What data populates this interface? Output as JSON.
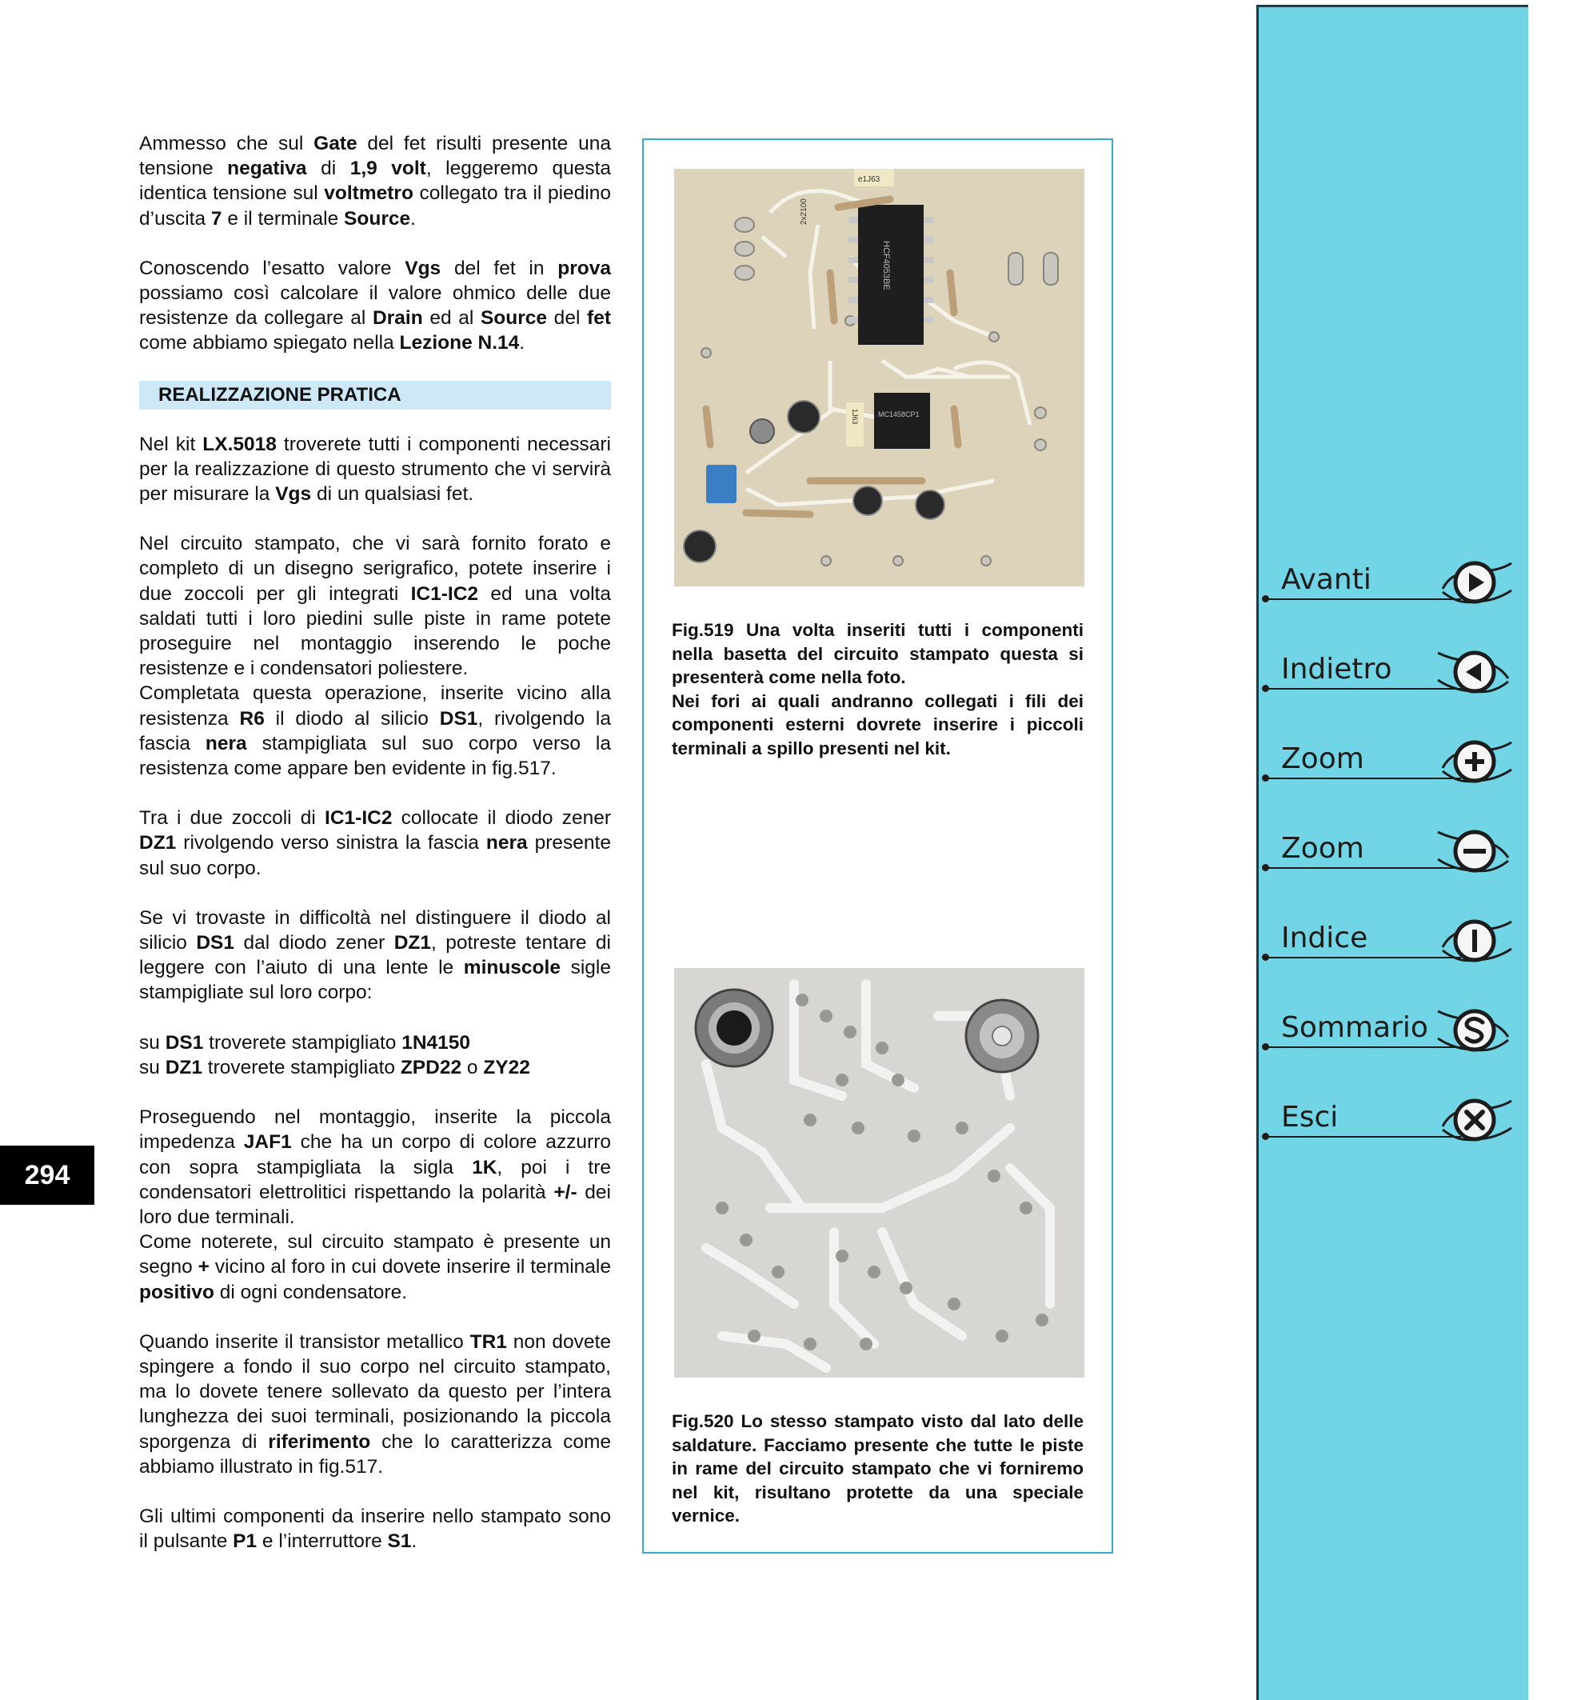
{
  "page_number": "294",
  "left_column": {
    "p1": [
      {
        "t": "Ammesso che sul "
      },
      {
        "b": "Gate"
      },
      {
        "t": " del fet risulti presente una tensione "
      },
      {
        "b": "negativa"
      },
      {
        "t": " di "
      },
      {
        "b": "1,9 volt"
      },
      {
        "t": ", leggeremo questa identica tensione sul "
      },
      {
        "b": "voltmetro"
      },
      {
        "t": " collegato tra il piedino d’uscita "
      },
      {
        "b": "7"
      },
      {
        "t": " e il terminale "
      },
      {
        "b": "Source"
      },
      {
        "t": "."
      }
    ],
    "p2": [
      {
        "t": "Conoscendo l’esatto valore "
      },
      {
        "b": "Vgs"
      },
      {
        "t": " del fet in "
      },
      {
        "b": "prova"
      },
      {
        "t": " possiamo così calcolare il valore ohmico delle due resistenze da collegare al "
      },
      {
        "b": "Drain"
      },
      {
        "t": " ed al "
      },
      {
        "b": "Source"
      },
      {
        "t": " del "
      },
      {
        "b": "fet"
      },
      {
        "t": " come abbiamo spiegato nella "
      },
      {
        "b": "Lezione N.14"
      },
      {
        "t": "."
      }
    ],
    "section_heading": "REALIZZAZIONE PRATICA",
    "p3": [
      {
        "t": "Nel kit "
      },
      {
        "b": "LX.5018"
      },
      {
        "t": " troverete tutti i componenti necessari per la realizzazione di questo strumento che vi servirà per misurare la "
      },
      {
        "b": "Vgs"
      },
      {
        "t": " di un qualsiasi fet."
      }
    ],
    "p4": [
      {
        "t": "Nel circuito stampato, che vi sarà fornito forato e completo di un disegno serigrafico, potete inserire i due zoccoli per gli integrati "
      },
      {
        "b": "IC1-IC2"
      },
      {
        "t": " ed una volta saldati tutti i loro piedini sulle piste in rame potete proseguire nel montaggio inserendo le poche resistenze e i condensatori poliestere."
      }
    ],
    "p5": [
      {
        "t": "Completata questa operazione, inserite vicino alla resistenza "
      },
      {
        "b": "R6"
      },
      {
        "t": " il diodo al silicio "
      },
      {
        "b": "DS1"
      },
      {
        "t": ", rivolgendo la fascia "
      },
      {
        "b": "nera"
      },
      {
        "t": " stampigliata sul suo corpo verso la resistenza come appare ben evidente in fig.517."
      }
    ],
    "p6": [
      {
        "t": "Tra i due zoccoli di "
      },
      {
        "b": "IC1-IC2"
      },
      {
        "t": " collocate il diodo zener "
      },
      {
        "b": "DZ1"
      },
      {
        "t": " rivolgendo verso sinistra la fascia "
      },
      {
        "b": "nera"
      },
      {
        "t": " presente sul suo corpo."
      }
    ],
    "p7": [
      {
        "t": "Se vi trovaste in difficoltà nel distinguere il diodo al silicio "
      },
      {
        "b": "DS1"
      },
      {
        "t": " dal diodo zener "
      },
      {
        "b": "DZ1"
      },
      {
        "t": ", potreste tentare di leggere con l’aiuto di una lente le "
      },
      {
        "b": "minuscole"
      },
      {
        "t": " sigle stampigliate sul loro corpo:"
      }
    ],
    "p8a": [
      {
        "t": "su "
      },
      {
        "b": "DS1"
      },
      {
        "t": " troverete stampigliato "
      },
      {
        "b": "1N4150"
      }
    ],
    "p8b": [
      {
        "t": "su "
      },
      {
        "b": "DZ1"
      },
      {
        "t": " troverete stampigliato "
      },
      {
        "b": "ZPD22"
      },
      {
        "t": " o "
      },
      {
        "b": "ZY22"
      }
    ],
    "p9": [
      {
        "t": "Proseguendo nel montaggio, inserite la piccola impedenza "
      },
      {
        "b": "JAF1"
      },
      {
        "t": " che ha un corpo di colore azzurro con sopra stampigliata la sigla "
      },
      {
        "b": "1K"
      },
      {
        "t": ", poi i tre condensatori elettrolitici rispettando la polarità "
      },
      {
        "b": "+/-"
      },
      {
        "t": " dei loro due terminali."
      }
    ],
    "p10": [
      {
        "t": "Come noterete, sul circuito stampato è presente un segno "
      },
      {
        "b": "+"
      },
      {
        "t": " vicino al foro in cui dovete inserire il terminale "
      },
      {
        "b": "positivo"
      },
      {
        "t": " di ogni condensatore."
      }
    ],
    "p11": [
      {
        "t": "Quando inserite il transistor metallico "
      },
      {
        "b": "TR1"
      },
      {
        "t": " non dovete spingere a fondo il suo corpo nel circuito stampato, ma lo dovete tenere sollevato da questo per l’intera lunghezza dei suoi terminali, posizionando la piccola sporgenza di "
      },
      {
        "b": "riferimento"
      },
      {
        "t": " che lo caratterizza come abbiamo illustrato in fig.517."
      }
    ],
    "p12": [
      {
        "t": "Gli ultimi componenti da inserire nello stampato sono il pulsante "
      },
      {
        "b": "P1"
      },
      {
        "t": " e l’interruttore "
      },
      {
        "b": "S1"
      },
      {
        "t": "."
      }
    ]
  },
  "figures": {
    "fig519": {
      "chip_top_label": "HCF4053BE",
      "chip_bottom_label": "MC1458CP1",
      "resistor_label": "2x2100",
      "component_label_1": "e1J63",
      "component_label_2": "1J63",
      "caption_p1": "Fig.519 Una volta inseriti tutti i componenti nella basetta del circuito stampato questa si presenterà come nella foto.",
      "caption_p2": "Nei fori ai quali andranno collegati i fili dei componenti esterni dovrete inserire i piccoli terminali a spillo presenti nel kit."
    },
    "fig520": {
      "caption": "Fig.520 Lo stesso stampato visto dal lato delle saldature. Facciamo presente che tutte le piste in rame del circuito stampato che vi forniremo nel kit, risultano protette da una speciale vernice."
    }
  },
  "nav": [
    {
      "label": "Avanti",
      "icon": "play-right-icon"
    },
    {
      "label": "Indietro",
      "icon": "play-left-icon"
    },
    {
      "label": "Zoom",
      "icon": "plus-icon"
    },
    {
      "label": "Zoom",
      "icon": "minus-icon"
    },
    {
      "label": "Indice",
      "icon": "info-i-icon"
    },
    {
      "label": "Sommario",
      "icon": "s-icon"
    },
    {
      "label": "Esci",
      "icon": "close-x-icon"
    }
  ],
  "colors": {
    "sidebar": "#72d5e6",
    "frame": "#38a9cf",
    "heading_bg": "#cde8f7"
  }
}
